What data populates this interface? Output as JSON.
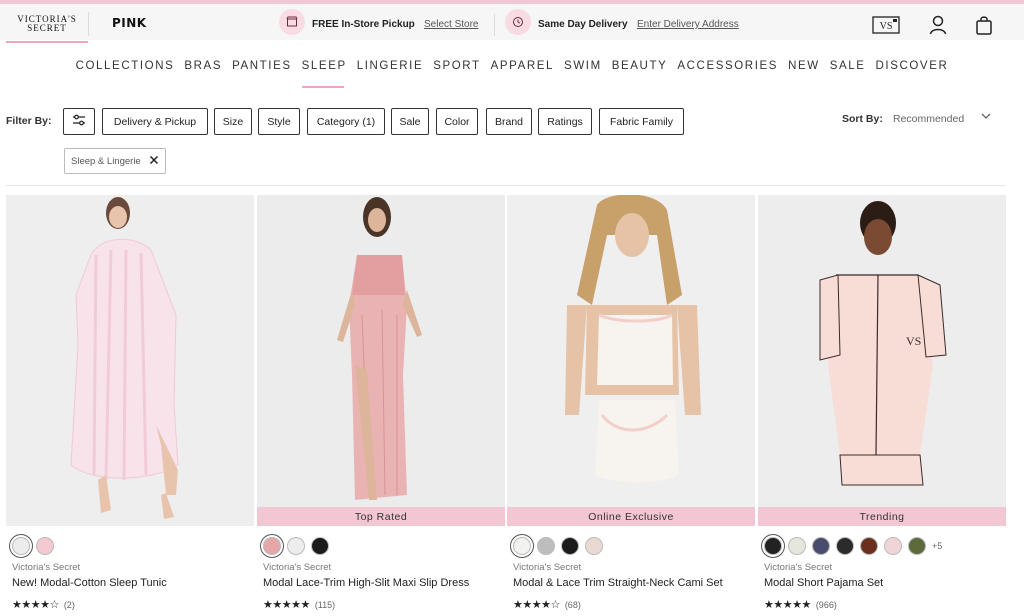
{
  "header": {
    "brand_logo_line1": "VICTORIA'S",
    "brand_logo_line2": "SECRET",
    "brand_pink": "PINK",
    "pickup_label": "FREE In-Store Pickup",
    "pickup_link": "Select Store",
    "delivery_label": "Same Day Delivery",
    "delivery_link": "Enter Delivery Address",
    "icons": [
      "gift-card-icon",
      "account-icon",
      "bag-icon"
    ]
  },
  "nav": {
    "items": [
      "COLLECTIONS",
      "BRAS",
      "PANTIES",
      "SLEEP",
      "LINGERIE",
      "SPORT",
      "APPAREL",
      "SWIM",
      "BEAUTY",
      "ACCESSORIES",
      "NEW",
      "SALE",
      "DISCOVER"
    ],
    "active": "SLEEP"
  },
  "filters": {
    "label": "Filter By:",
    "buttons": [
      "Delivery & Pickup",
      "Size",
      "Style",
      "Category (1)",
      "Sale",
      "Color",
      "Brand",
      "Ratings",
      "Fabric Family"
    ],
    "active_chip": "Sleep & Lingerie",
    "sort_label": "Sort By:",
    "sort_value": "Recommended"
  },
  "products": [
    {
      "badge": "",
      "brand": "Victoria's Secret",
      "name": "New! Modal-Cotton Sleep Tunic",
      "stars": "★★★★☆",
      "reviews": "(2)",
      "swatches": [
        "#ececec",
        "#f3c9d2"
      ],
      "more": ""
    },
    {
      "badge": "Top Rated",
      "brand": "Victoria's Secret",
      "name": "Modal Lace-Trim High-Slit Maxi Slip Dress",
      "stars": "★★★★★",
      "reviews": "(115)",
      "swatches": [
        "#e7a6a8",
        "#ededed",
        "#1b1b1b"
      ],
      "more": ""
    },
    {
      "badge": "Online Exclusive",
      "brand": "Victoria's Secret",
      "name": "Modal & Lace Trim Straight-Neck Cami Set",
      "stars": "★★★★☆",
      "reviews": "(68)",
      "swatches": [
        "#f2f2ee",
        "#bdbdbd",
        "#1b1b1b",
        "#ead9d2"
      ],
      "more": ""
    },
    {
      "badge": "Trending",
      "brand": "Victoria's Secret",
      "name": "Modal Short Pajama Set",
      "stars": "★★★★★",
      "reviews": "(966)",
      "swatches": [
        "#222222",
        "#e6e6dc",
        "#4a4c6e",
        "#2b2b2b",
        "#6b2f1e",
        "#f1d4d8",
        "#5d6b3c"
      ],
      "more": "+5"
    }
  ],
  "colors": {
    "accent_pink": "#f3c6d3",
    "topbar_bg": "#f6f6f6",
    "photo_bg": "#ececec"
  }
}
